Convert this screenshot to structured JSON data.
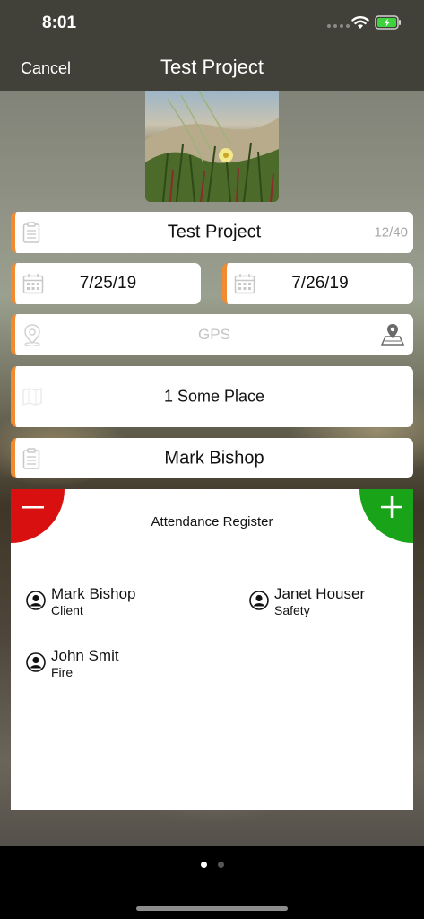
{
  "status": {
    "time": "8:01"
  },
  "nav": {
    "cancel": "Cancel",
    "title": "Test Project"
  },
  "form": {
    "project_name": "Test Project",
    "project_counter": "12/40",
    "start_date": "7/25/19",
    "end_date": "7/26/19",
    "gps_placeholder": "GPS",
    "location": "1 Some Place",
    "person": "Mark Bishop"
  },
  "attendance": {
    "title": "Attendance Register",
    "people": [
      {
        "name": "Mark Bishop",
        "role": "Client"
      },
      {
        "name": "Janet Houser",
        "role": "Safety"
      },
      {
        "name": "John Smit",
        "role": "Fire"
      }
    ]
  },
  "pager": {
    "active_index": 0,
    "count": 2
  },
  "colors": {
    "accent": "#f28b30",
    "remove": "#d81010",
    "add": "#19a319",
    "bar": "#414039"
  },
  "icons": [
    "clipboard-icon",
    "calendar-icon",
    "location-pin-icon",
    "map-pin-icon",
    "map-icon",
    "person-icon",
    "minus-icon",
    "plus-icon",
    "wifi-icon",
    "battery-icon"
  ]
}
